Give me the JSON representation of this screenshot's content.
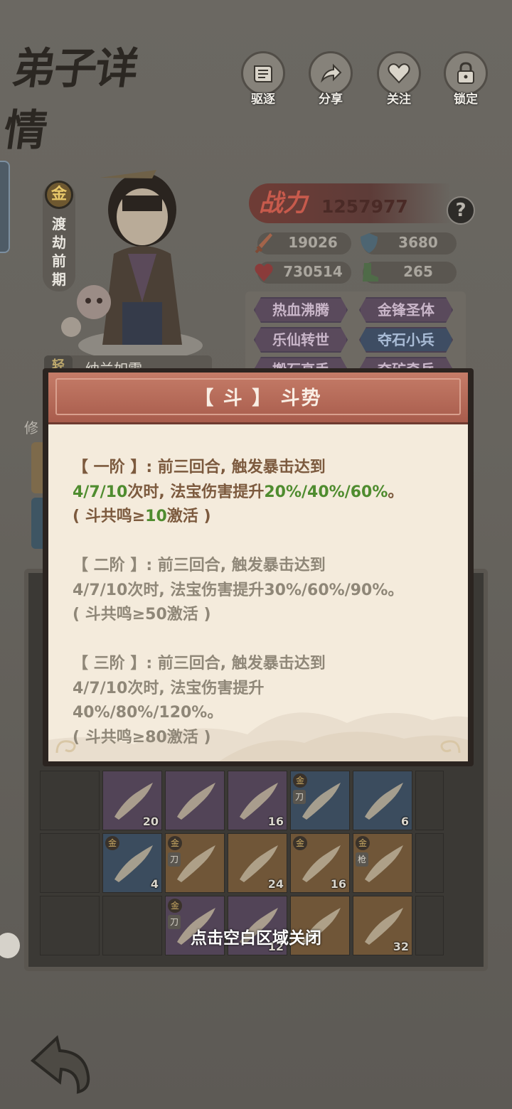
{
  "header": {
    "title": "弟子详情",
    "actions": [
      {
        "label": "驱逐",
        "icon": "scroll-icon"
      },
      {
        "label": "分享",
        "icon": "share-arrow-icon"
      },
      {
        "label": "关注",
        "icon": "heart-icon"
      },
      {
        "label": "锁定",
        "icon": "lock-icon"
      }
    ]
  },
  "disciple": {
    "rank_badge": "金",
    "realm": "渡劫前期",
    "name_tag": "轻",
    "name": "纳兰如雪"
  },
  "power": {
    "label": "战力",
    "value": "1257977",
    "help": "?"
  },
  "stats": [
    {
      "icon": "sword-icon",
      "value": "19026"
    },
    {
      "icon": "shield-icon",
      "value": "3680"
    },
    {
      "icon": "heart-hp-icon",
      "value": "730514"
    },
    {
      "icon": "boot-icon",
      "value": "265"
    }
  ],
  "traits": [
    {
      "label": "热血沸腾",
      "tone": "purple"
    },
    {
      "label": "金锋圣体",
      "tone": "purple"
    },
    {
      "label": "乐仙转世",
      "tone": "purple"
    },
    {
      "label": "夺石小兵",
      "tone": "blue"
    },
    {
      "label": "搬石高手",
      "tone": "purple"
    },
    {
      "label": "夺矿奇兵",
      "tone": "purple"
    }
  ],
  "cultivation_label": "修",
  "equipment_grid": [
    {
      "row": 0,
      "col": 1,
      "tone": "purple",
      "num": "20",
      "gold": false,
      "kind": ""
    },
    {
      "row": 0,
      "col": 2,
      "tone": "purple",
      "num": "",
      "gold": false,
      "kind": ""
    },
    {
      "row": 0,
      "col": 3,
      "tone": "purple",
      "num": "16",
      "gold": false,
      "kind": ""
    },
    {
      "row": 0,
      "col": 4,
      "tone": "blue",
      "num": "",
      "gold": true,
      "kind": "刀"
    },
    {
      "row": 0,
      "col": 5,
      "tone": "blue",
      "num": "6",
      "gold": false,
      "kind": ""
    },
    {
      "row": 1,
      "col": 1,
      "tone": "blue",
      "num": "4",
      "gold": true,
      "kind": ""
    },
    {
      "row": 1,
      "col": 2,
      "tone": "orange",
      "num": "",
      "gold": true,
      "kind": "刀"
    },
    {
      "row": 1,
      "col": 3,
      "tone": "orange",
      "num": "24",
      "gold": false,
      "kind": ""
    },
    {
      "row": 1,
      "col": 4,
      "tone": "orange",
      "num": "16",
      "gold": true,
      "kind": ""
    },
    {
      "row": 1,
      "col": 5,
      "tone": "orange",
      "num": "",
      "gold": true,
      "kind": "枪"
    },
    {
      "row": 2,
      "col": 2,
      "tone": "purple",
      "num": "",
      "gold": true,
      "kind": "刀"
    },
    {
      "row": 2,
      "col": 3,
      "tone": "purple",
      "num": "12",
      "gold": false,
      "kind": ""
    },
    {
      "row": 2,
      "col": 4,
      "tone": "orange",
      "num": "",
      "gold": false,
      "kind": ""
    },
    {
      "row": 2,
      "col": 5,
      "tone": "orange",
      "num": "32",
      "gold": false,
      "kind": ""
    }
  ],
  "modal": {
    "title": "【 斗 】 斗势",
    "tiers": [
      {
        "active": true,
        "prefix": "【 一阶 】: 前三回合, 触发暴击达到",
        "counts": "4/7/10",
        "mid": "次时, 法宝伤害提升",
        "boost": "20%/40%/60%",
        "end": "。",
        "cond_open": "( 斗共鸣≥",
        "cond_num": "10",
        "cond_close": "激活 )"
      },
      {
        "active": false,
        "prefix": "【 二阶 】: 前三回合, 触发暴击达到",
        "counts": "4/7/10",
        "mid": "次时, 法宝伤害提升",
        "boost": "30%/60%/90%",
        "end": "。",
        "cond_open": "( 斗共鸣≥",
        "cond_num": "50",
        "cond_close": "激活 )"
      },
      {
        "active": false,
        "prefix": "【 三阶 】: 前三回合, 触发暴击达到",
        "counts": "4/7/10",
        "mid": "次时, 法宝伤害提升",
        "boost": "40%/80%/120%",
        "end": "。",
        "cond_open": "( 斗共鸣≥",
        "cond_num": "80",
        "cond_close": "激活 )"
      }
    ]
  },
  "close_hint": "点击空白区域关闭",
  "colors": {
    "highlight_green": "#4f8c2f",
    "header_red": "#b86a58",
    "paper": "#f4ebdc"
  }
}
